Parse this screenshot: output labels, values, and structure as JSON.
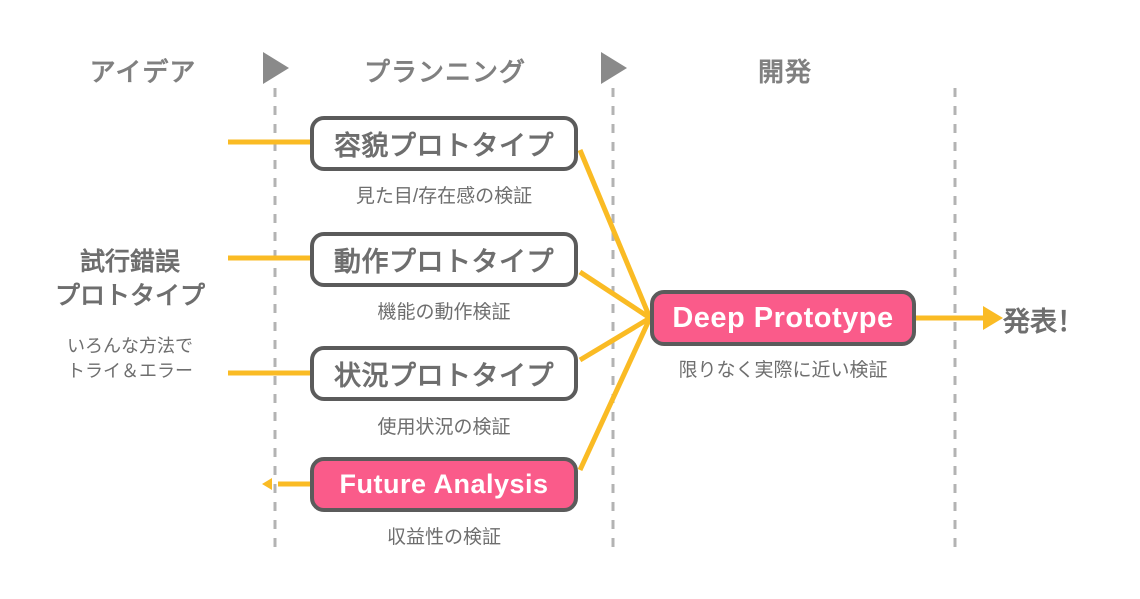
{
  "diagram": {
    "colors": {
      "accent_pink": "#fa5b8a",
      "connector_orange": "#fabb24",
      "box_border_gray": "#5b5b5b",
      "text_gray": "#6e6e6e",
      "header_gray": "#808080",
      "divider_gray": "#b3b3b3"
    },
    "stages": [
      {
        "label": "アイデア"
      },
      {
        "label": "プランニング"
      },
      {
        "label": "開発"
      }
    ],
    "stage_separators": [
      {
        "name": "idea-to-planning-marker"
      },
      {
        "name": "planning-to-development-marker"
      }
    ],
    "left_group": {
      "title_line1": "試行錯誤",
      "title_line2": "プロトタイプ",
      "sub_line1": "いろんな方法で",
      "sub_line2": "トライ＆エラー"
    },
    "prototypes": [
      {
        "label": "容貌プロトタイプ",
        "caption": "見た目/存在感の検証",
        "accent": false
      },
      {
        "label": "動作プロトタイプ",
        "caption": "機能の動作検証",
        "accent": false
      },
      {
        "label": "状況プロトタイプ",
        "caption": "使用状況の検証",
        "accent": false
      },
      {
        "label": "Future Analysis",
        "caption": "収益性の検証",
        "accent": true
      }
    ],
    "deep": {
      "label": "Deep Prototype",
      "caption": "限りなく実際に近い検証"
    },
    "outcome": {
      "label": "発表！"
    }
  }
}
